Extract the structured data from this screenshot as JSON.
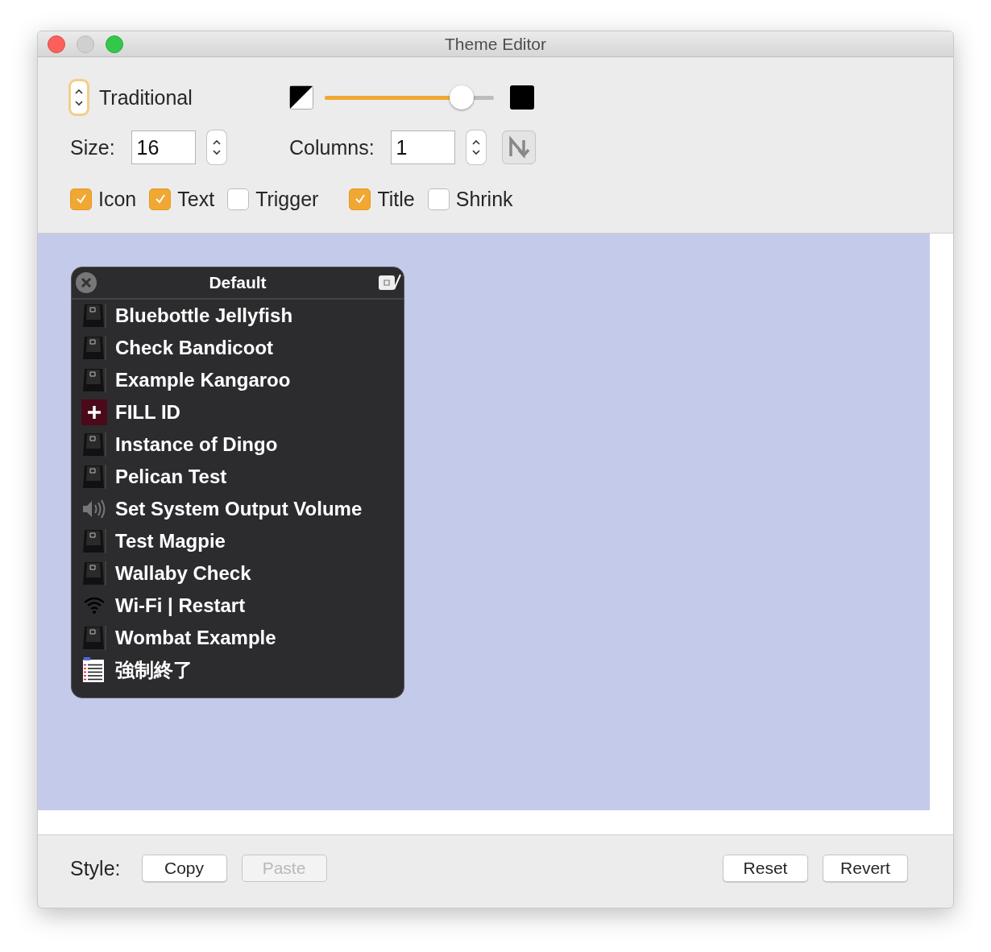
{
  "window": {
    "title": "Theme Editor"
  },
  "style_popup": {
    "label": "Traditional"
  },
  "opacity_slider": {
    "level": 0.81
  },
  "size": {
    "label": "Size:",
    "value": "16"
  },
  "columns": {
    "label": "Columns:",
    "value": "1"
  },
  "option_groups": [
    [
      {
        "label": "Icon",
        "checked": true
      },
      {
        "label": "Text",
        "checked": true
      },
      {
        "label": "Trigger",
        "checked": false
      }
    ],
    [
      {
        "label": "Title",
        "checked": true
      },
      {
        "label": "Shrink",
        "checked": false
      }
    ]
  ],
  "preview": {
    "title": "Default",
    "items": [
      {
        "label": "Bluebottle Jellyfish",
        "kind": "keyboard"
      },
      {
        "label": "Check Bandicoot",
        "kind": "keyboard"
      },
      {
        "label": "Example Kangaroo",
        "kind": "keyboard"
      },
      {
        "label": "FILL ID",
        "kind": "add"
      },
      {
        "label": "Instance of Dingo",
        "kind": "keyboard"
      },
      {
        "label": "Pelican Test",
        "kind": "keyboard"
      },
      {
        "label": "Set System Output Volume",
        "kind": "volume"
      },
      {
        "label": "Test Magpie",
        "kind": "keyboard"
      },
      {
        "label": "Wallaby Check",
        "kind": "keyboard"
      },
      {
        "label": "Wi-Fi | Restart",
        "kind": "wifi"
      },
      {
        "label": "Wombat Example",
        "kind": "keyboard"
      },
      {
        "label": "強制終了",
        "kind": "list"
      }
    ]
  },
  "footer": {
    "label": "Style:",
    "left_buttons": [
      {
        "label": "Copy",
        "disabled": false
      },
      {
        "label": "Paste",
        "disabled": true
      }
    ],
    "right_buttons": [
      {
        "label": "Reset",
        "disabled": false
      },
      {
        "label": "Revert",
        "disabled": false
      }
    ]
  }
}
